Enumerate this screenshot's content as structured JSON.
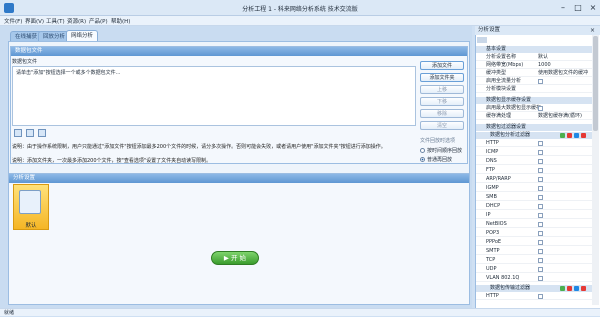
{
  "window": {
    "title": "分析工程 1 - 科来网络分析系统 技术交流版"
  },
  "menu": [
    "文件(F)",
    "界面(V)",
    "工具(T)",
    "资源(R)",
    "产品(P)",
    "帮助(H)"
  ],
  "tabs": [
    "在线捕获",
    "回放分析",
    "网络分析"
  ],
  "packet_section": {
    "header": "数据包文件",
    "placeholder": "请单击\"添加\"按钮选择一个或多个数据包文件...",
    "buttons": [
      "添加文件",
      "添加文件夹",
      "上移",
      "下移",
      "移除",
      "清空"
    ],
    "option_label": "文件回放时选项",
    "radios": [
      "按时间顺序回放",
      "普通再回放"
    ],
    "radio_selected": 1,
    "note1": "说明：由于操作系统限制，用户只能通过\"添加文件\"按钮添加最多200个文件的时候，请分多次操作。否则可能会失败，或者请用户使用\"添加文件夹\"按钮进行添加操作。",
    "note2": "说明：添加文件夹，一次最多添加200个文件，按\"查看选项\"设置了文件夹自动读写限制。"
  },
  "analysis_section": {
    "header": "分析设置",
    "card_label": "默认"
  },
  "start_button": {
    "label": "▶ 开 始"
  },
  "right_panel": {
    "title": "分析设置",
    "groups": [
      {
        "name": "基本设置"
      },
      {
        "name": "数据包显示缓存设置"
      },
      {
        "name": "数据包过滤器设置"
      }
    ],
    "basic_rows": [
      {
        "k": "分析设置名称",
        "v": "默认"
      },
      {
        "k": "网络带宽(Mbps)",
        "v": "1000"
      },
      {
        "k": "缓冲类型",
        "v": "使用数据包文件的缓冲"
      },
      {
        "k": "启用全流量分析",
        "v": ""
      },
      {
        "k": "分析模块设置",
        "v": ""
      }
    ],
    "cache_rows": [
      {
        "k": "启用最大数据包显示缓存",
        "v": ""
      },
      {
        "k": "缓存满处理",
        "v": "数据包缓存满(循环)"
      }
    ],
    "filter_sub1": "数据包分析过滤器",
    "filter_sub2": "数据包传输过滤器",
    "protocols": [
      "HTTP",
      "ICMP",
      "DNS",
      "FTP",
      "ARP/RARP",
      "IGMP",
      "SMB",
      "DHCP",
      "IP",
      "NetBIOS",
      "POP3",
      "PPPoE",
      "SMTP",
      "TCP",
      "UDP",
      "VLAN 802.1Q"
    ],
    "protocols2": [
      "HTTP"
    ]
  },
  "status": {
    "text": "就绪"
  },
  "colors": {
    "accent": "#2f79c8",
    "tab_active": "#f7fbff",
    "start_green": "#3a9c2d"
  }
}
